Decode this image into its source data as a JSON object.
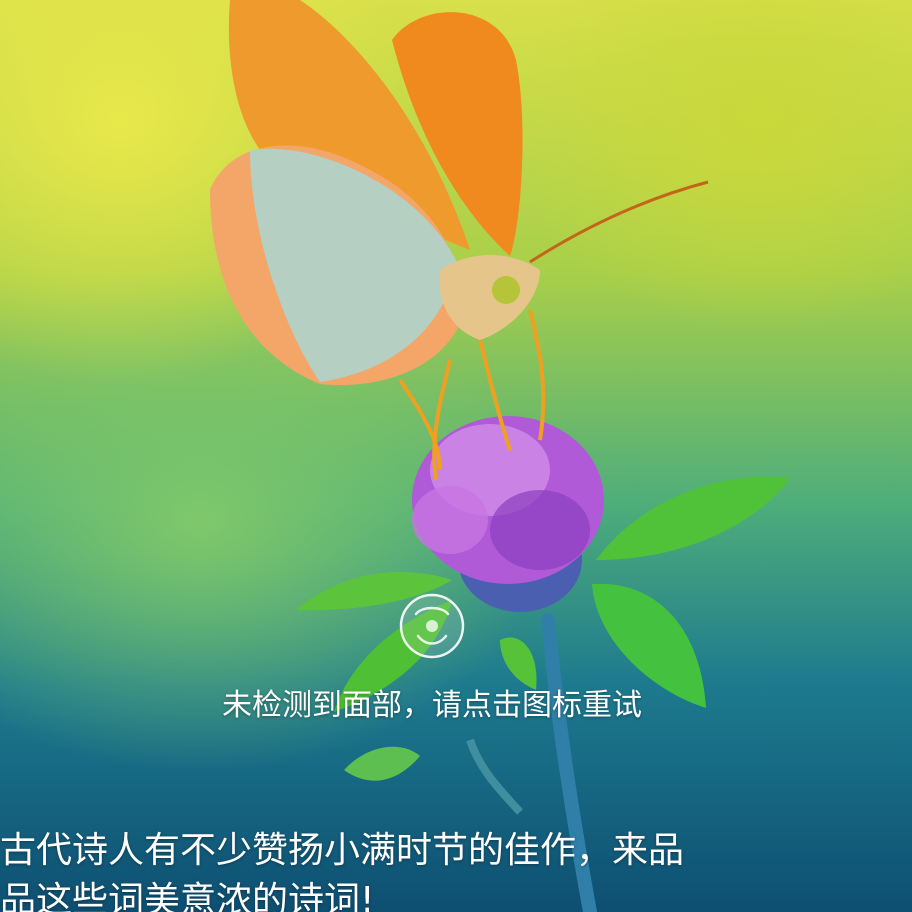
{
  "lock_screen": {
    "face_unlock": {
      "status_text": "未检测到面部，请点击图标重试",
      "icon": "face-unlock-retry-icon"
    },
    "wallpaper": {
      "caption": "古代诗人有不少赞扬小满时节的佳作，来品品这些词美意浓的诗词!"
    }
  }
}
